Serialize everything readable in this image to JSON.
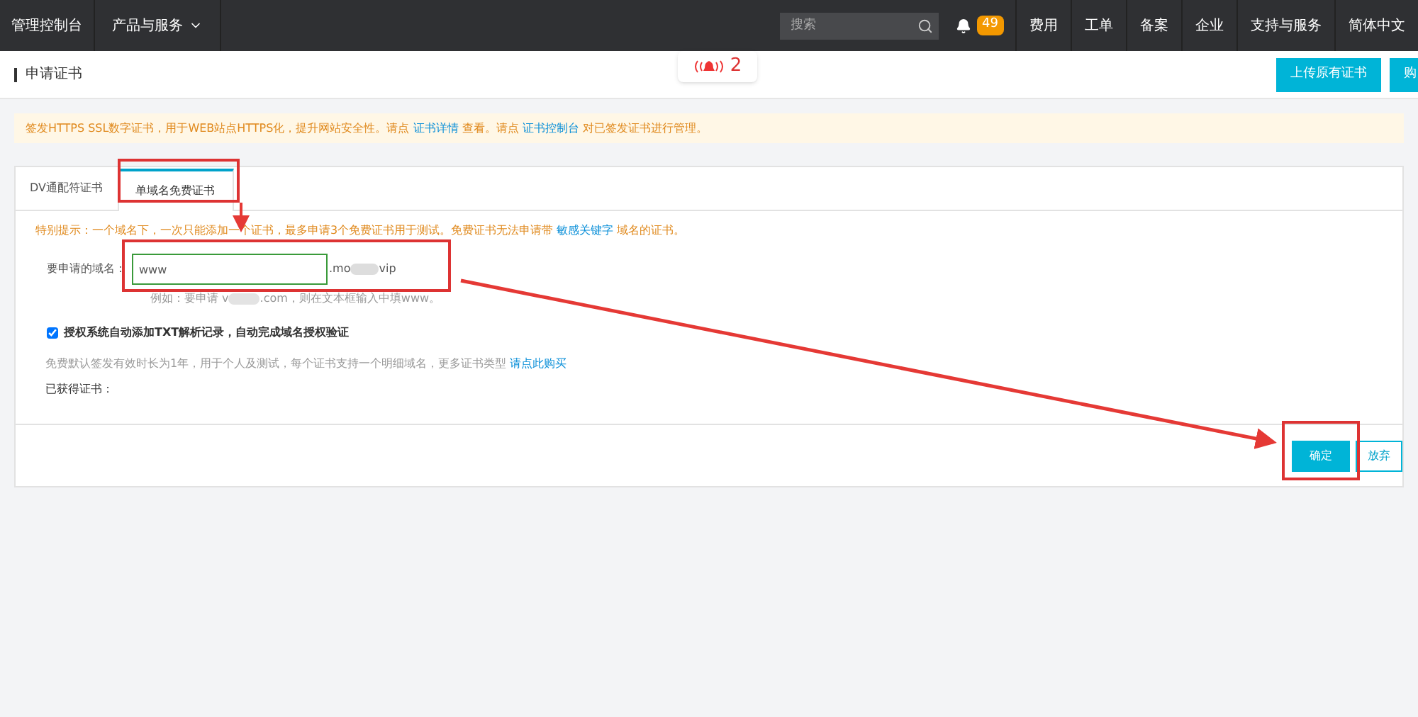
{
  "topbar": {
    "brand": "管理控制台",
    "products": "产品与服务",
    "search": {
      "placeholder": "搜索"
    },
    "bell_count": "49",
    "links": [
      "费用",
      "工单",
      "备案",
      "企业",
      "支持与服务",
      "简体中文"
    ]
  },
  "header": {
    "title": "申请证书",
    "alert": {
      "count": "2"
    },
    "buttons": [
      "上传原有证书",
      "购"
    ]
  },
  "notice": [
    {
      "kind": "text",
      "text": "签发HTTPS SSL数字证书，用于WEB站点HTTPS化，提升网站安全性。请点 "
    },
    {
      "kind": "link",
      "text": "证书详情"
    },
    {
      "kind": "text",
      "text": " 查看。请点 "
    },
    {
      "kind": "link",
      "text": "证书控制台"
    },
    {
      "kind": "text",
      "text": " 对已签发证书进行管理。"
    }
  ],
  "tabs": [
    {
      "label": "DV通配符证书",
      "selected": false
    },
    {
      "label": "单域名免费证书",
      "selected": true
    }
  ],
  "tip": [
    {
      "kind": "text",
      "text": "特别提示：一个域名下，一次只能添加一个证书，最多申请3个免费证书用于测试。免费证书无法申请带 "
    },
    {
      "kind": "link",
      "text": "敏感关键字"
    },
    {
      "kind": "text",
      "text": " 域名的证书。"
    }
  ],
  "domain": {
    "label": "要申请的域名：",
    "value": "www",
    "suffix_start": ".mo",
    "suffix_end": "vip",
    "example_start": "例如：要申请 v",
    "example_end": ".com，则在文本框输入中填www。"
  },
  "authorize": {
    "label": "授权系统自动添加TXT解析记录，自动完成域名授权验证",
    "checked": true
  },
  "info": [
    {
      "kind": "text",
      "text": "免费默认签发有效时长为1年，用于个人及测试，每个证书支持一个明细域名，更多证书类型 "
    },
    {
      "kind": "link",
      "text": "请点此购买"
    }
  ],
  "obtained": "已获得证书：",
  "actions": [
    {
      "label": "确定",
      "kind": "primary"
    },
    {
      "label": "放弃",
      "kind": "secondary"
    }
  ]
}
